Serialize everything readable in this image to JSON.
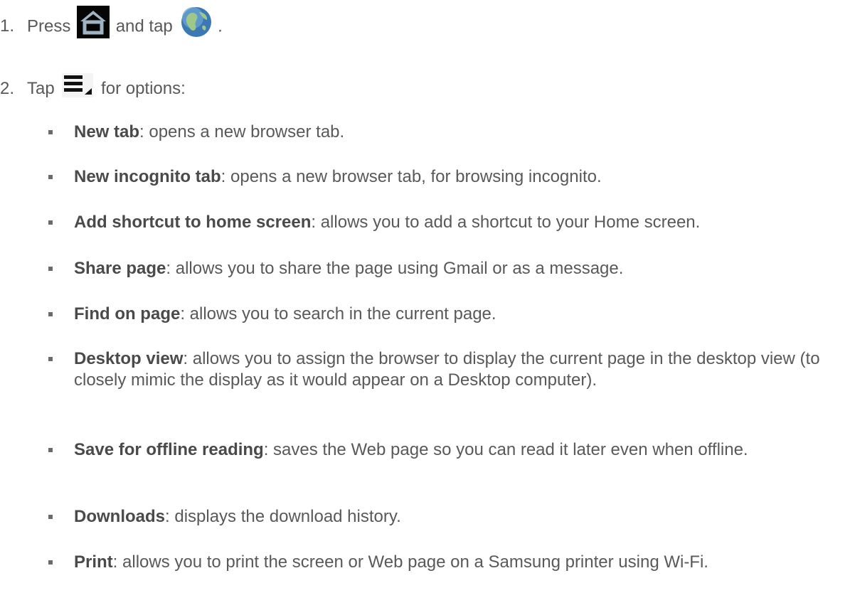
{
  "steps": [
    {
      "number": "1.",
      "part1": "Press",
      "icon1": "home-icon",
      "part2": "and tap",
      "icon2": "globe-icon",
      "part3": "."
    },
    {
      "number": "2.",
      "part1": "Tap",
      "icon1": "menu-icon",
      "part2": "for options:"
    }
  ],
  "options": [
    {
      "term": "New tab",
      "desc": ": opens a new browser tab."
    },
    {
      "term": "New incognito tab",
      "desc": ": opens a new browser tab, for browsing incognito."
    },
    {
      "term": "Add shortcut to home screen",
      "desc": ": allows you to add a shortcut to your Home screen."
    },
    {
      "term": "Share page",
      "desc": ": allows you to share the page using Gmail or as a message."
    },
    {
      "term": "Find on page",
      "desc": ": allows you to search in the current page."
    },
    {
      "term": "Desktop view",
      "desc": ": allows you to assign the browser to display the current page in the desktop view (to closely mimic the display as it would appear on a Desktop computer)."
    },
    {
      "term": "Save for offline reading",
      "desc": ": saves the Web page so you can read it later even when offline."
    },
    {
      "term": "Downloads",
      "desc": ": displays the download history."
    },
    {
      "term": "Print",
      "desc": ": allows you to print the screen or Web page on a Samsung printer using Wi-Fi."
    }
  ],
  "colors": {
    "text": "#595959",
    "term": "#4a4a4a",
    "bullet": "#6b6b6b"
  }
}
